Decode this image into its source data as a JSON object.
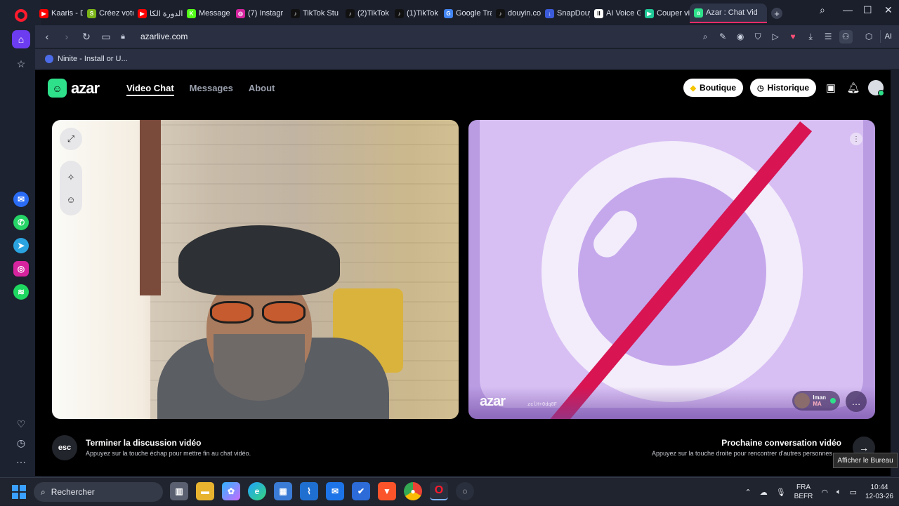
{
  "browser": {
    "tabs": [
      {
        "label": "Kaaris - De",
        "fav_color": "#ff0000",
        "fav_glyph": "▶",
        "icon": "youtube-icon"
      },
      {
        "label": "Créez votr",
        "fav_color": "#7ab317",
        "fav_glyph": "S",
        "icon": "shopify-icon"
      },
      {
        "label": "الدورة الكا",
        "fav_color": "#ff0000",
        "fav_glyph": "▶",
        "icon": "youtube-icon"
      },
      {
        "label": "Message M",
        "fav_color": "#53fc18",
        "fav_glyph": "K",
        "icon": "kick-icon"
      },
      {
        "label": "(7) Instagr",
        "fav_color": "#d6249f",
        "fav_glyph": "◎",
        "icon": "instagram-icon"
      },
      {
        "label": "TikTok Stu",
        "fav_color": "#111111",
        "fav_glyph": "♪",
        "icon": "tiktok-icon"
      },
      {
        "label": "(2)TikTok",
        "fav_color": "#111111",
        "fav_glyph": "♪",
        "icon": "tiktok-icon"
      },
      {
        "label": "(1)TikTok",
        "fav_color": "#111111",
        "fav_glyph": "♪",
        "icon": "tiktok-icon"
      },
      {
        "label": "Google Tra",
        "fav_color": "#4285f4",
        "fav_glyph": "G",
        "icon": "google-translate-icon"
      },
      {
        "label": "douyin.co",
        "fav_color": "#111111",
        "fav_glyph": "♪",
        "icon": "douyin-icon"
      },
      {
        "label": "SnapDouy",
        "fav_color": "#3b5bdb",
        "fav_glyph": "↓",
        "icon": "snapdouyin-icon"
      },
      {
        "label": "AI Voice G",
        "fav_color": "#ffffff",
        "fav_glyph": "II",
        "icon": "ai-voice-icon"
      },
      {
        "label": "Couper vic",
        "fav_color": "#20c997",
        "fav_glyph": "▶",
        "icon": "video-cutter-icon"
      },
      {
        "label": "Azar : Chat Vid",
        "fav_color": "#2fe08a",
        "fav_glyph": "a",
        "icon": "azar-icon",
        "active": true
      }
    ],
    "url": "azarlive.com",
    "bookmark": "Ninite - Install or U...",
    "ai_label": "AI"
  },
  "azar": {
    "nav": {
      "video_chat": "Video Chat",
      "messages": "Messages",
      "about": "About"
    },
    "logo_text": "azar",
    "boutique": "Boutique",
    "historique": "Historique",
    "remote": {
      "watermark": "azar",
      "watermark_id": "zclH+0dq8F",
      "user_name": "Iman",
      "user_country": "MA"
    },
    "footer": {
      "esc_key": "esc",
      "end_title": "Terminer la discussion vidéo",
      "end_sub": "Appuyez sur la touche échap pour mettre fin au chat vidéo.",
      "next_title": "Prochaine conversation vidéo",
      "next_sub": "Appuyez sur la touche droite pour rencontrer d'autres personnes"
    },
    "colors": {
      "brand": "#2fe08a",
      "remote_bg": "#d7bff3",
      "slash": "#d81452"
    }
  },
  "tooltip": "Afficher le Bureau",
  "taskbar": {
    "search_placeholder": "Rechercher",
    "lang_top": "FRA",
    "lang_bottom": "BEFR",
    "time": "10:44",
    "date": "12-03-26"
  }
}
